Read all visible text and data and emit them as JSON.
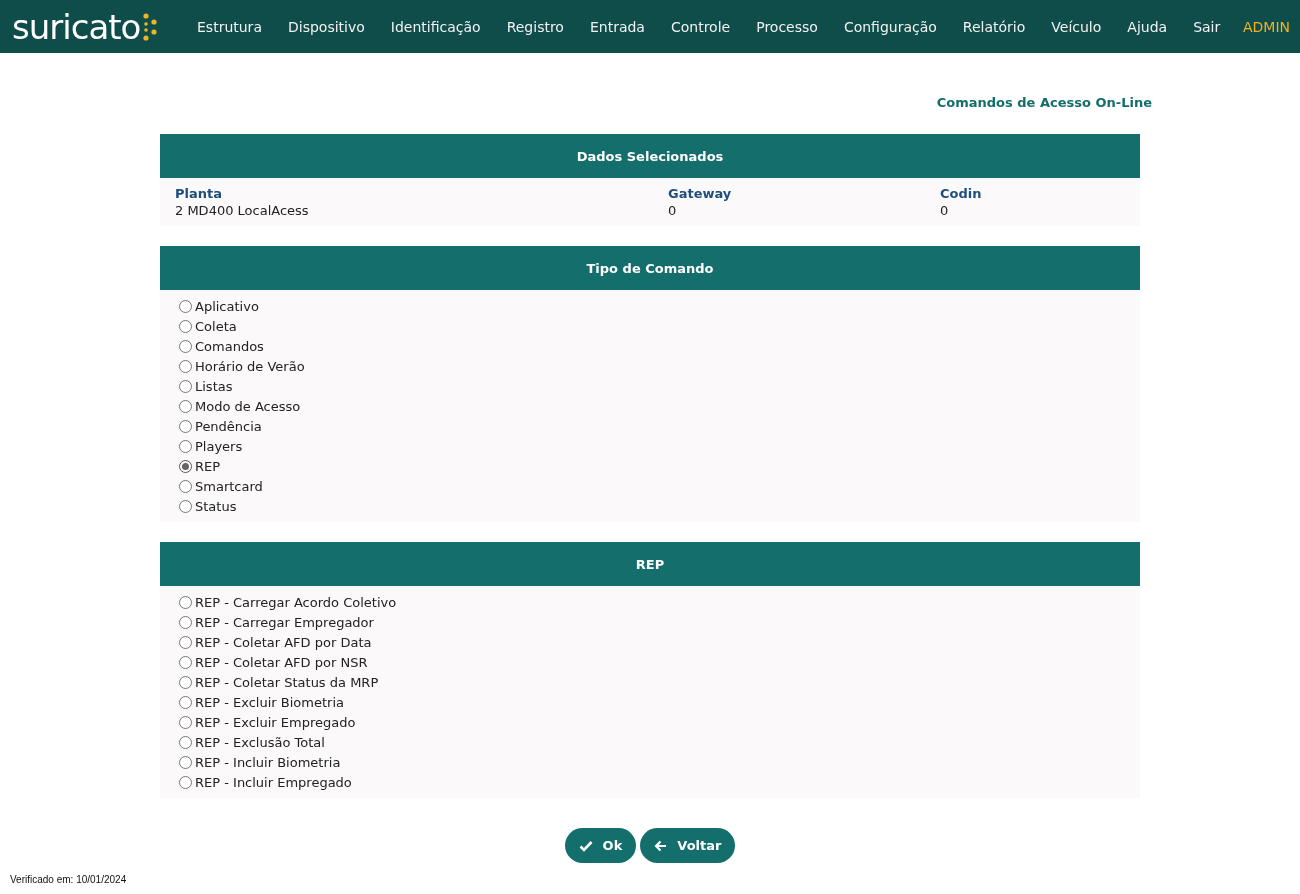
{
  "header": {
    "logo": "suricato",
    "menu": [
      "Estrutura",
      "Dispositivo",
      "Identificação",
      "Registro",
      "Entrada",
      "Controle",
      "Processo",
      "Configuração",
      "Relatório",
      "Veículo",
      "Ajuda",
      "Sair"
    ],
    "user": "ADMIN"
  },
  "page_title": "Comandos de Acesso On-Line",
  "selected_data": {
    "title": "Dados Selecionados",
    "fields": [
      {
        "label": "Planta",
        "value": "2 MD400 LocalAcess"
      },
      {
        "label": "Gateway",
        "value": "0"
      },
      {
        "label": "Codin",
        "value": "0"
      }
    ]
  },
  "command_type": {
    "title": "Tipo de Comando",
    "options": [
      {
        "label": "Aplicativo",
        "selected": false
      },
      {
        "label": "Coleta",
        "selected": false
      },
      {
        "label": "Comandos",
        "selected": false
      },
      {
        "label": "Horário de Verão",
        "selected": false
      },
      {
        "label": "Listas",
        "selected": false
      },
      {
        "label": "Modo de Acesso",
        "selected": false
      },
      {
        "label": "Pendência",
        "selected": false
      },
      {
        "label": "Players",
        "selected": false
      },
      {
        "label": "REP",
        "selected": true
      },
      {
        "label": "Smartcard",
        "selected": false
      },
      {
        "label": "Status",
        "selected": false
      }
    ]
  },
  "rep": {
    "title": "REP",
    "options": [
      {
        "label": "REP - Carregar Acordo Coletivo",
        "selected": false
      },
      {
        "label": "REP - Carregar Empregador",
        "selected": false
      },
      {
        "label": "REP - Coletar AFD por Data",
        "selected": false
      },
      {
        "label": "REP - Coletar AFD por NSR",
        "selected": false
      },
      {
        "label": "REP - Coletar Status da MRP",
        "selected": false
      },
      {
        "label": "REP - Excluir Biometria",
        "selected": false
      },
      {
        "label": "REP - Excluir Empregado",
        "selected": false
      },
      {
        "label": "REP - Exclusão Total",
        "selected": false
      },
      {
        "label": "REP - Incluir Biometria",
        "selected": false
      },
      {
        "label": "REP - Incluir Empregado",
        "selected": false
      }
    ]
  },
  "buttons": [
    {
      "label": "Ok",
      "kind": "check"
    },
    {
      "label": "Voltar",
      "kind": "back"
    }
  ],
  "footer": "Verificado em: 10/01/2024"
}
